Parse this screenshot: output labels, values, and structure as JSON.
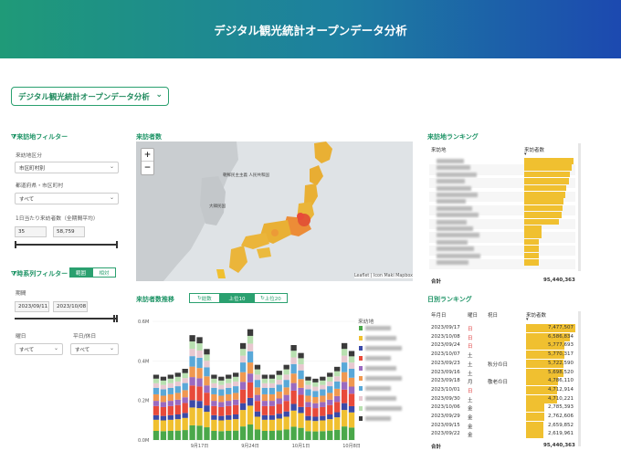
{
  "header": {
    "title": "デジタル観光統計オープンデータ分析"
  },
  "app_selector": {
    "label": "デジタル観光統計オープンデータ分析"
  },
  "destination_filter": {
    "title": "来訪地フィルター",
    "division_label": "来訪地区分",
    "division_value": "市区町村別",
    "pref_label": "都道府県・市区町村",
    "pref_value": "すべて",
    "visitors_label": "1日当たり来訪者数（全期間平均）",
    "min": "35",
    "max": "58,759"
  },
  "timeseries_filter": {
    "title": "時系列フィルター",
    "tab_period": "範囲",
    "tab_relative": "相対",
    "period_label": "期間",
    "start": "2023/09/11",
    "end": "2023/10/08",
    "weekday_label": "曜日",
    "weekday_value": "すべて",
    "holiday_label": "平日/休日",
    "holiday_value": "すべて"
  },
  "map": {
    "title": "来訪者数",
    "zoom_in": "+",
    "zoom_out": "−",
    "attribution": "Leaflet | Icon Maki Mapbox",
    "labels": [
      "朝鮮民主主義\n人民共和国",
      "大韓民国"
    ]
  },
  "trend": {
    "title": "来訪者数推移",
    "tabs": [
      "総数",
      "上位10",
      "上位20"
    ],
    "legend_title": "来訪地",
    "y_ticks": [
      "0.0M",
      "0.2M",
      "0.4M",
      "0.6M"
    ],
    "x_ticks": [
      "9月17日",
      "9月24日",
      "10月1日",
      "10月8日"
    ]
  },
  "chart_data": {
    "type": "bar",
    "stacked": true,
    "x": [
      "2023/09/11",
      "2023/09/12",
      "2023/09/13",
      "2023/09/14",
      "2023/09/15",
      "2023/09/16",
      "2023/09/17",
      "2023/09/18",
      "2023/09/19",
      "2023/09/20",
      "2023/09/21",
      "2023/09/22",
      "2023/09/23",
      "2023/09/24",
      "2023/09/25",
      "2023/09/26",
      "2023/09/27",
      "2023/09/28",
      "2023/09/29",
      "2023/09/30",
      "2023/10/01",
      "2023/10/02",
      "2023/10/03",
      "2023/10/04",
      "2023/10/05",
      "2023/10/06",
      "2023/10/07",
      "2023/10/08"
    ],
    "totals": [
      0.33,
      0.32,
      0.33,
      0.34,
      0.36,
      0.53,
      0.52,
      0.46,
      0.33,
      0.32,
      0.33,
      0.34,
      0.49,
      0.56,
      0.38,
      0.33,
      0.33,
      0.35,
      0.38,
      0.48,
      0.44,
      0.32,
      0.31,
      0.32,
      0.34,
      0.37,
      0.49,
      0.45
    ],
    "colors": [
      "#4aa84a",
      "#f0c030",
      "#3b4aa8",
      "#e84a3a",
      "#9a6ac0",
      "#f09850",
      "#59a8d8",
      "#e8c8d0",
      "#b8e0b0",
      "#3a3a3a"
    ],
    "ylim": [
      0,
      0.6
    ],
    "ylabel": ""
  },
  "ranking": {
    "title": "来訪地ランキング",
    "col_place": "来訪地",
    "col_visitors": "来訪者数",
    "bars": [
      1.0,
      0.97,
      0.93,
      0.9,
      0.85,
      0.83,
      0.8,
      0.78,
      0.75,
      0.7,
      0.35,
      0.35,
      0.3,
      0.3,
      0.3,
      0.3
    ],
    "total_label": "合計",
    "total_value": "95,440,363"
  },
  "daily": {
    "title": "日別ランキング",
    "cols": [
      "年月日",
      "曜日",
      "祝日",
      "来訪者数"
    ],
    "rows": [
      {
        "date": "2023/09/17",
        "dow": "日",
        "hol": "",
        "val": "7,477,507",
        "r": 1.0
      },
      {
        "date": "2023/10/08",
        "dow": "日",
        "hol": "",
        "val": "6,586,834",
        "r": 0.88
      },
      {
        "date": "2023/09/24",
        "dow": "日",
        "hol": "",
        "val": "5,777,693",
        "r": 0.77
      },
      {
        "date": "2023/10/07",
        "dow": "土",
        "hol": "",
        "val": "5,770,317",
        "r": 0.77
      },
      {
        "date": "2023/09/23",
        "dow": "土",
        "hol": "秋分の日",
        "val": "5,722,590",
        "r": 0.765
      },
      {
        "date": "2023/09/16",
        "dow": "土",
        "hol": "",
        "val": "5,698,520",
        "r": 0.76
      },
      {
        "date": "2023/09/18",
        "dow": "月",
        "hol": "敬老の日",
        "val": "4,786,110",
        "r": 0.64
      },
      {
        "date": "2023/10/01",
        "dow": "日",
        "hol": "",
        "val": "4,712,914",
        "r": 0.63
      },
      {
        "date": "2023/09/30",
        "dow": "土",
        "hol": "",
        "val": "4,710,221",
        "r": 0.63
      },
      {
        "date": "2023/10/06",
        "dow": "金",
        "hol": "",
        "val": "2,785,393",
        "r": 0.37
      },
      {
        "date": "2023/09/29",
        "dow": "金",
        "hol": "",
        "val": "2,762,606",
        "r": 0.37
      },
      {
        "date": "2023/09/15",
        "dow": "金",
        "hol": "",
        "val": "2,659,852",
        "r": 0.355
      },
      {
        "date": "2023/09/22",
        "dow": "金",
        "hol": "",
        "val": "2,619,961",
        "r": 0.35
      }
    ],
    "total_label": "合計",
    "total_value": "95,440,363"
  }
}
